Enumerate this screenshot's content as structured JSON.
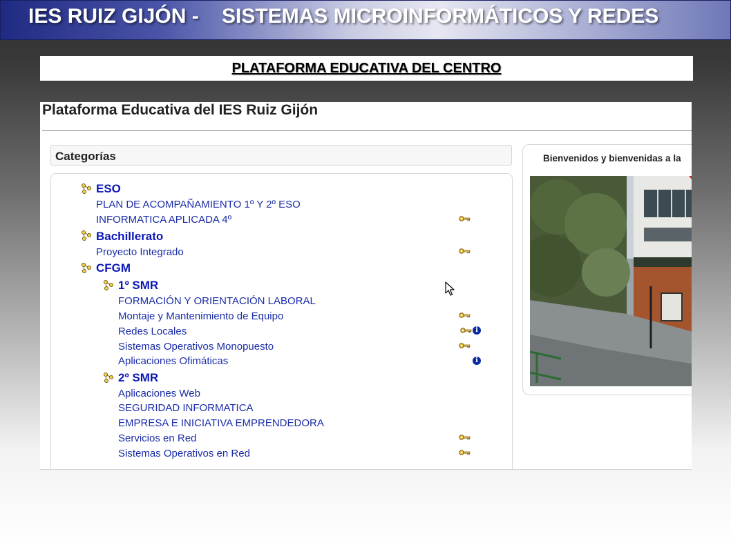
{
  "header": {
    "title": "IES RUIZ GIJÓN -    SISTEMAS MICROINFORMÁTICOS Y REDES"
  },
  "banner": {
    "label": "PLATAFORMA EDUCATIVA DEL CENTRO"
  },
  "site": {
    "title": "Plataforma Educativa del IES Ruiz Gijón"
  },
  "categories": {
    "heading": "Categorías",
    "eso": {
      "label": "ESO",
      "courses": [
        "PLAN DE ACOMPAÑAMIENTO 1º Y 2º ESO",
        "INFORMATICA APLICADA 4º"
      ]
    },
    "bachillerato": {
      "label": "Bachillerato",
      "courses": [
        "Proyecto Integrado"
      ]
    },
    "cfgm": {
      "label": "CFGM",
      "smr1": {
        "label": "1º SMR",
        "courses": [
          "FORMACIÓN Y ORIENTACIÓN LABORAL",
          "Montaje y Mantenimiento de Equipo",
          "Redes Locales",
          "Sistemas Operativos Monopuesto",
          "Aplicaciones Ofimáticas"
        ]
      },
      "smr2": {
        "label": "2º SMR",
        "courses": [
          "Aplicaciones Web",
          "SEGURIDAD INFORMATICA",
          "EMPRESA E INICIATIVA EMPRENDEDORA",
          "Servicios en Red",
          "Sistemas Operativos en Red"
        ]
      }
    }
  },
  "welcome": {
    "text": "Bienvenidos y bienvenidas a la"
  },
  "icons": {
    "category": "category-node-icon",
    "guest_key": "key-icon",
    "info": "info-icon",
    "cursor": "mouse-cursor-icon"
  },
  "colors": {
    "header_gradient_start": "#1f2a82",
    "link_blue": "#1a2ca8",
    "category_blue": "#0b18b8",
    "info_blue": "#0a2a9e"
  }
}
